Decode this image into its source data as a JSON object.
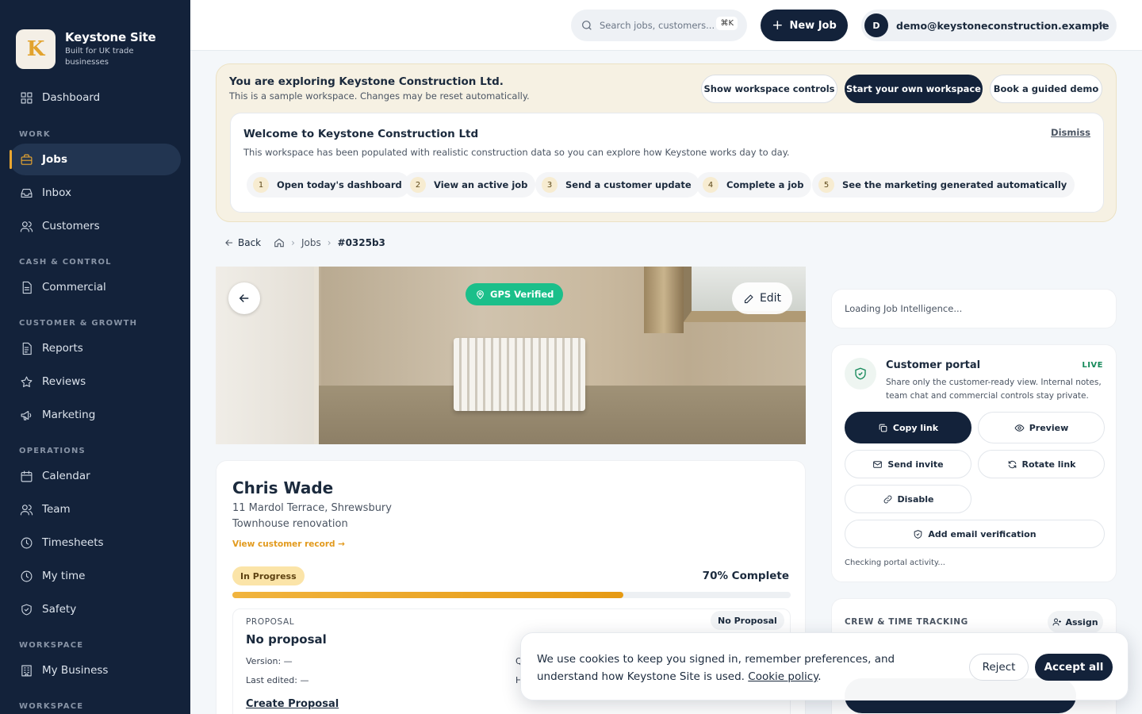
{
  "brand": {
    "name": "Keystone Site",
    "tagline": "Built for UK trade businesses",
    "logo_letter": "K"
  },
  "sidebar": {
    "items": [
      {
        "label": "Dashboard",
        "icon": "grid-icon"
      },
      {
        "label": "Jobs",
        "icon": "briefcase-icon",
        "active": true
      },
      {
        "label": "Inbox",
        "icon": "inbox-icon"
      },
      {
        "label": "Customers",
        "icon": "users-icon"
      },
      {
        "label": "Commercial",
        "icon": "document-icon"
      },
      {
        "label": "Reports",
        "icon": "report-icon"
      },
      {
        "label": "Reviews",
        "icon": "star-icon"
      },
      {
        "label": "Marketing",
        "icon": "megaphone-icon"
      },
      {
        "label": "Calendar",
        "icon": "calendar-icon"
      },
      {
        "label": "Team",
        "icon": "users-icon"
      },
      {
        "label": "Timesheets",
        "icon": "clock-icon"
      },
      {
        "label": "My time",
        "icon": "clock-icon"
      },
      {
        "label": "Safety",
        "icon": "shield-icon"
      },
      {
        "label": "My Business",
        "icon": "building-icon"
      }
    ],
    "sections": [
      "WORK",
      "CASH & CONTROL",
      "CUSTOMER & GROWTH",
      "OPERATIONS",
      "WORKSPACE",
      "WORKSPACE"
    ]
  },
  "topbar": {
    "search_placeholder": "Search jobs, customers...",
    "search_shortcut": "⌘K",
    "new_job_label": "New Job",
    "account_initial": "D",
    "account_email": "demo@keystoneconstruction.example"
  },
  "banner": {
    "title": "You are exploring Keystone Construction Ltd.",
    "subtitle": "This is a sample workspace. Changes may be reset automatically.",
    "buttons": [
      "Show workspace controls",
      "Start your own workspace",
      "Book a guided demo"
    ],
    "welcome_title": "Welcome to Keystone Construction Ltd",
    "welcome_desc": "This workspace has been populated with realistic construction data so you can explore how Keystone works day to day.",
    "dismiss": "Dismiss",
    "steps": [
      {
        "num": "1",
        "label": "Open today's dashboard"
      },
      {
        "num": "2",
        "label": "View an active job"
      },
      {
        "num": "3",
        "label": "Send a customer update"
      },
      {
        "num": "4",
        "label": "Complete a job"
      },
      {
        "num": "5",
        "label": "See the marketing generated automatically"
      }
    ]
  },
  "breadcrumb": {
    "back": "Back",
    "jobs": "Jobs",
    "current": "#0325b3"
  },
  "hero": {
    "gps_label": "GPS Verified",
    "edit_label": "Edit"
  },
  "job": {
    "customer_name": "Chris Wade",
    "address": "11 Mardol Terrace, Shrewsbury",
    "project": "Townhouse renovation",
    "view_record": "View customer record →",
    "status": "In Progress",
    "percent_label": "70% Complete",
    "progress": 0.7
  },
  "proposal": {
    "label": "PROPOSAL",
    "title": "No proposal",
    "badge": "No Proposal",
    "version": "Version: —",
    "last_edited": "Last edited: —",
    "right_q": "Q",
    "right_h": "H",
    "create": "Create Proposal"
  },
  "intel": {
    "loading": "Loading Job Intelligence..."
  },
  "portal": {
    "title": "Customer portal",
    "status": "LIVE",
    "description": "Share only the customer-ready view. Internal notes, team chat and commercial controls stay private.",
    "copy": "Copy link",
    "preview": "Preview",
    "send": "Send invite",
    "rotate": "Rotate link",
    "disable": "Disable",
    "verify": "Add email verification",
    "activity": "Checking portal activity..."
  },
  "crew": {
    "title": "CREW & TIME TRACKING",
    "assign": "Assign"
  },
  "cookie": {
    "text": "We use cookies to keep you signed in, remember preferences, and understand how Keystone Site is used.",
    "link": "Cookie policy",
    "reject": "Reject",
    "accept": "Accept all"
  },
  "colors": {
    "navy": "#13223a",
    "accent": "#e9a630",
    "green": "#1bbf8a"
  }
}
